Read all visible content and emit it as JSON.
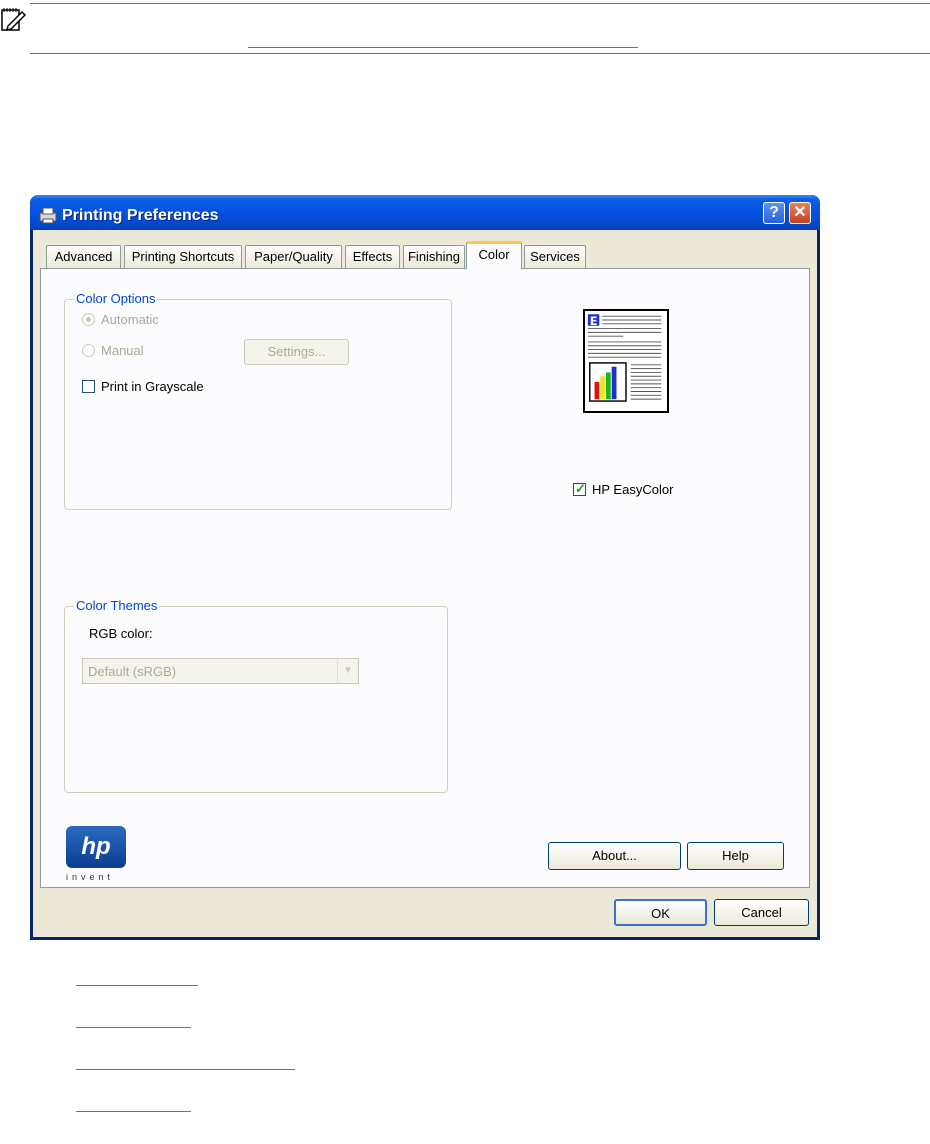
{
  "window": {
    "title": "Printing Preferences"
  },
  "tabs": [
    "Advanced",
    "Printing Shortcuts",
    "Paper/Quality",
    "Effects",
    "Finishing",
    "Color",
    "Services"
  ],
  "active_tab": "Color",
  "color_options": {
    "title": "Color Options",
    "automatic_label": "Automatic",
    "manual_label": "Manual",
    "settings_button": "Settings...",
    "grayscale_label": "Print in Grayscale"
  },
  "easycolor": {
    "label": "HP EasyColor",
    "checked": true
  },
  "color_themes": {
    "title": "Color Themes",
    "rgb_label": "RGB color:",
    "rgb_value": "Default (sRGB)"
  },
  "logo": {
    "text": "hp",
    "sub": "invent"
  },
  "buttons": {
    "about": "About...",
    "help": "Help",
    "ok": "OK",
    "cancel": "Cancel"
  },
  "colors": {
    "title_bar": "#0551e0",
    "group_title": "#0046d5",
    "link_rule": "#3a7fc2"
  }
}
